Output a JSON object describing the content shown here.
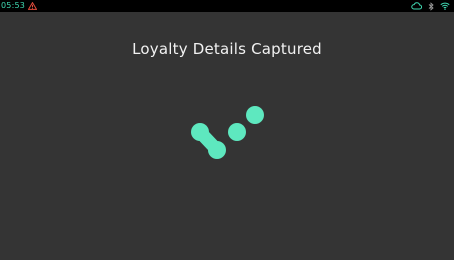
{
  "status_bar": {
    "time": "05:53",
    "accent_color": "#3fd9b2",
    "alert_color": "#e14b3b",
    "icons": [
      "warning-icon",
      "cloud-icon",
      "bluetooth-icon",
      "wifi-icon"
    ]
  },
  "main": {
    "title": "Loyalty Details Captured",
    "background_color": "#343434",
    "loader_color": "#5ee8bf"
  }
}
